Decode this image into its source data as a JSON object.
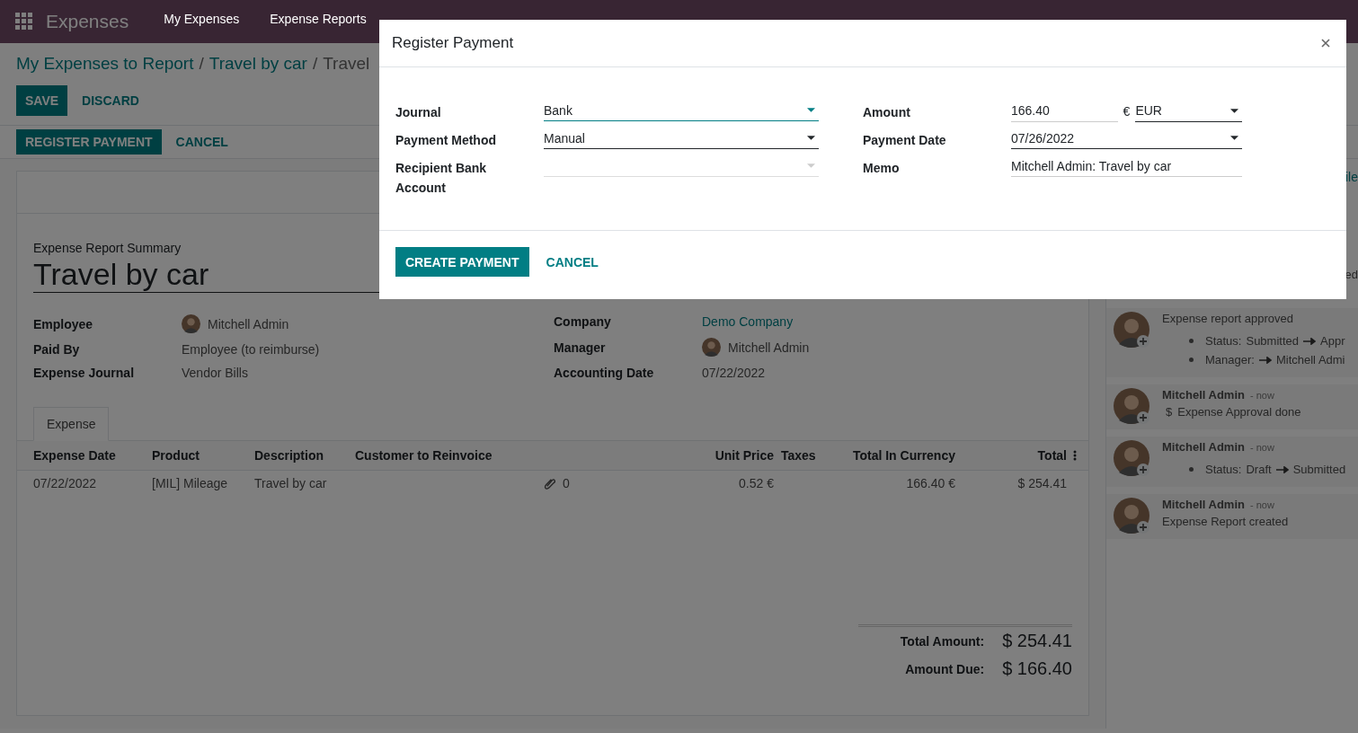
{
  "navbar": {
    "app": "Expenses",
    "menu": [
      "My Expenses",
      "Expense Reports"
    ]
  },
  "breadcrumb": {
    "separator": "/",
    "items": [
      {
        "label": "My Expenses to Report",
        "link": true
      },
      {
        "label": "Travel by car",
        "link": true
      },
      {
        "label": "Travel",
        "link": false
      }
    ]
  },
  "form_buttons": [
    {
      "label": "SAVE",
      "primary": true
    },
    {
      "label": "DISCARD",
      "primary": false
    }
  ],
  "status_buttons": [
    {
      "label": "REGISTER PAYMENT",
      "primary": true
    },
    {
      "label": "CANCEL",
      "primary": false
    }
  ],
  "sheet": {
    "summary_label": "Expense Report Summary",
    "title": "Travel by car",
    "fields_left": [
      {
        "label": "Employee",
        "value": "Mitchell Admin",
        "avatar": true,
        "link": false
      },
      {
        "label": "Paid By",
        "value": "Employee (to reimburse)",
        "avatar": false,
        "link": false
      },
      {
        "label": "Expense Journal",
        "value": "Vendor Bills",
        "avatar": false,
        "link": false
      }
    ],
    "fields_right": [
      {
        "label": "Company",
        "value": "Demo Company",
        "avatar": false,
        "link": true
      },
      {
        "label": "Manager",
        "value": "Mitchell Admin",
        "avatar": true,
        "link": false
      },
      {
        "label": "Accounting Date",
        "value": "07/22/2022",
        "avatar": false,
        "link": false
      }
    ],
    "tabs": [
      {
        "label": "Expense",
        "selected": true
      }
    ],
    "table": {
      "columns": [
        "Expense Date",
        "Product",
        "Description",
        "Customer to Reinvoice",
        "",
        "Unit Price",
        "Taxes",
        "Total In Currency",
        "Total"
      ],
      "rows": [
        {
          "cells": [
            "07/22/2022",
            "[MIL] Mileage",
            "Travel by car",
            "",
            "0",
            "0.52 €",
            "",
            "166.40 €",
            "$ 254.41"
          ]
        }
      ]
    },
    "totals": [
      {
        "label": "Total Amount:",
        "value": "$ 254.41"
      },
      {
        "label": "Amount Due:",
        "value": "$ 166.40"
      }
    ]
  },
  "chatter": {
    "fragments": [
      "ile",
      "ed"
    ],
    "messages": [
      {
        "body": "Expense report approved",
        "tracking": [
          {
            "field": "Status:",
            "old": "Submitted",
            "new": "Appr"
          },
          {
            "field": "Manager:",
            "new": "Mitchell Admi"
          }
        ]
      },
      {
        "author": "Mitchell Admin",
        "time": "- now",
        "activity_icon": "$",
        "body": "Expense Approval done"
      },
      {
        "author": "Mitchell Admin",
        "time": "- now",
        "tracking": [
          {
            "field": "Status:",
            "old": "Draft",
            "new": "Submitted"
          }
        ]
      },
      {
        "author": "Mitchell Admin",
        "time": "- now",
        "body": "Expense Report created"
      }
    ]
  },
  "dialog": {
    "title": "Register Payment",
    "fields": [
      {
        "label": "Journal",
        "kind": "select",
        "value": "Bank",
        "focused": true,
        "disabled": false
      },
      {
        "label": "Amount",
        "kind": "amount",
        "value": "166.40",
        "currency_symbol": "€",
        "currency": "EUR",
        "focused": false,
        "disabled": false
      },
      {
        "label": "Payment Method",
        "kind": "select",
        "value": "Manual",
        "focused": false,
        "disabled": false
      },
      {
        "label": "Payment Date",
        "kind": "select",
        "value": "07/26/2022",
        "focused": false,
        "disabled": false
      },
      {
        "label": "Recipient Bank Account",
        "kind": "select",
        "focused": false,
        "disabled": true
      },
      {
        "label": "Memo",
        "kind": "text",
        "value": "Mitchell Admin: Travel by car",
        "focused": false,
        "disabled": false
      }
    ],
    "buttons": [
      {
        "label": "CREATE PAYMENT",
        "primary": true
      },
      {
        "label": "CANCEL",
        "primary": false
      }
    ]
  }
}
